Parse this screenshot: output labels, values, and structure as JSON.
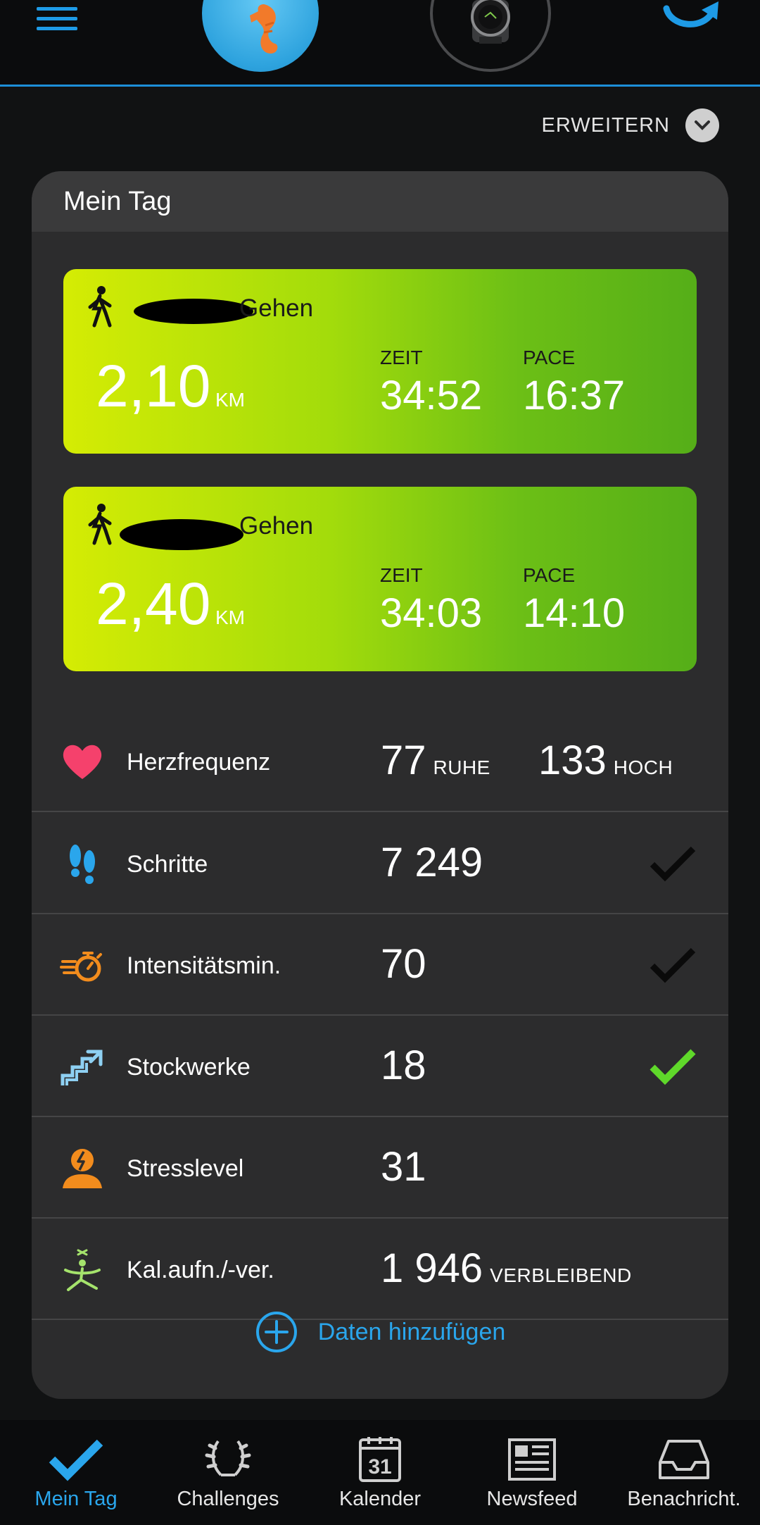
{
  "header": {
    "avatar_name": "seahorse-avatar",
    "device_name": "watch-device"
  },
  "expand": {
    "label": "ERWEITERN"
  },
  "card": {
    "title": "Mein Tag",
    "activities": [
      {
        "name": "Gehen",
        "distance": "2,10",
        "unit": "KM",
        "time_label": "ZEIT",
        "time": "34:52",
        "pace_label": "PACE",
        "pace": "16:37"
      },
      {
        "name": "Gehen",
        "distance": "2,40",
        "unit": "KM",
        "time_label": "ZEIT",
        "time": "34:03",
        "pace_label": "PACE",
        "pace": "14:10"
      }
    ],
    "metrics": {
      "heart": {
        "label": "Herzfrequenz",
        "rest": "77",
        "rest_unit": "RUHE",
        "high": "133",
        "high_unit": "HOCH",
        "color": "#f5416c"
      },
      "steps": {
        "label": "Schritte",
        "value": "7 249",
        "goal_met": false,
        "color": "#2aa6ec"
      },
      "intensity": {
        "label": "Intensitätsmin.",
        "value": "70",
        "goal_met": false,
        "color": "#f28c1d"
      },
      "floors": {
        "label": "Stockwerke",
        "value": "18",
        "goal_met": true,
        "color": "#8ed0f2"
      },
      "stress": {
        "label": "Stresslevel",
        "value": "31",
        "color": "#f28c1d"
      },
      "calories": {
        "label": "Kal.aufn./-ver.",
        "value": "1 946",
        "unit": "VERBLEIBEND",
        "color": "#a5e36c"
      }
    },
    "add_data": {
      "label": "Daten hinzufügen"
    }
  },
  "nav": {
    "items": [
      {
        "label": "Mein Tag",
        "icon": "checkmark-icon",
        "active": true
      },
      {
        "label": "Challenges",
        "icon": "laurel-icon"
      },
      {
        "label": "Kalender",
        "icon": "calendar-icon",
        "day": "31"
      },
      {
        "label": "Newsfeed",
        "icon": "newspaper-icon"
      },
      {
        "label": "Benachricht.",
        "icon": "inbox-icon"
      }
    ]
  },
  "colors": {
    "accent": "#1e9be6",
    "check_done": "#5fd82a",
    "check_pending": "#0a0a0a"
  }
}
